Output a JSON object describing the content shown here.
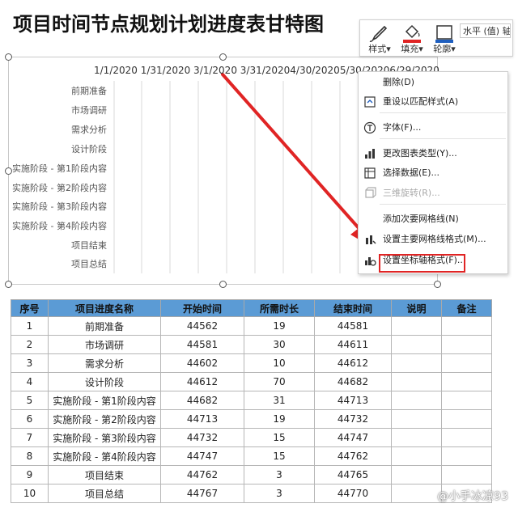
{
  "title": "项目时间节点规划计划进度表甘特图",
  "toolbar": {
    "style_label": "样式",
    "fill_label": "填充",
    "outline_label": "轮廓",
    "axis_select": "水平 (值) 轴",
    "colors": {
      "fill_accent": "#e02424",
      "outline_accent": "#1f5fbf"
    }
  },
  "chart_data": {
    "type": "bar",
    "orientation": "horizontal",
    "x_tick_labels": [
      "1/1/2020",
      "1/31/2020",
      "3/1/2020",
      "3/31/2020",
      "4/30/2020",
      "5/30/2020",
      "6/29/2020"
    ],
    "categories": [
      "前期准备",
      "市场调研",
      "需求分析",
      "设计阶段",
      "实施阶段 - 第1阶段内容",
      "实施阶段 - 第2阶段内容",
      "实施阶段 - 第3阶段内容",
      "实施阶段 - 第4阶段内容",
      "项目结束",
      "项目总结"
    ],
    "grid": true
  },
  "context_menu": {
    "items": [
      {
        "label": "删除(D)",
        "icon": "none",
        "disabled": false
      },
      {
        "label": "重设以匹配样式(A)",
        "icon": "reset-style-icon",
        "disabled": false
      },
      {
        "label": "字体(F)...",
        "icon": "font-icon",
        "disabled": false
      },
      {
        "label": "更改图表类型(Y)...",
        "icon": "chart-type-icon",
        "disabled": false
      },
      {
        "label": "选择数据(E)...",
        "icon": "select-data-icon",
        "disabled": false
      },
      {
        "label": "三维旋转(R)...",
        "icon": "rotate-3d-icon",
        "disabled": true
      },
      {
        "label": "添加次要网格线(N)",
        "icon": "none",
        "disabled": false
      },
      {
        "label": "设置主要网格线格式(M)...",
        "icon": "gridline-format-icon",
        "disabled": false
      },
      {
        "label": "设置坐标轴格式(F)...",
        "icon": "axis-format-icon",
        "disabled": false
      }
    ]
  },
  "table": {
    "headers": [
      "序号",
      "项目进度名称",
      "开始时间",
      "所需时长",
      "结束时间",
      "说明",
      "备注"
    ],
    "header_color": "#5b9bd5",
    "rows": [
      [
        "1",
        "前期准备",
        "44562",
        "19",
        "44581",
        "",
        ""
      ],
      [
        "2",
        "市场调研",
        "44581",
        "30",
        "44611",
        "",
        ""
      ],
      [
        "3",
        "需求分析",
        "44602",
        "10",
        "44612",
        "",
        ""
      ],
      [
        "4",
        "设计阶段",
        "44612",
        "70",
        "44682",
        "",
        ""
      ],
      [
        "5",
        "实施阶段 - 第1阶段内容",
        "44682",
        "31",
        "44713",
        "",
        ""
      ],
      [
        "6",
        "实施阶段 - 第2阶段内容",
        "44713",
        "19",
        "44732",
        "",
        ""
      ],
      [
        "7",
        "实施阶段 - 第3阶段内容",
        "44732",
        "15",
        "44747",
        "",
        ""
      ],
      [
        "8",
        "实施阶段 - 第4阶段内容",
        "44747",
        "15",
        "44762",
        "",
        ""
      ],
      [
        "9",
        "项目结束",
        "44762",
        "3",
        "44765",
        "",
        ""
      ],
      [
        "10",
        "项目总结",
        "44767",
        "3",
        "44770",
        "",
        ""
      ]
    ]
  },
  "watermark": "@小手冰凉93"
}
